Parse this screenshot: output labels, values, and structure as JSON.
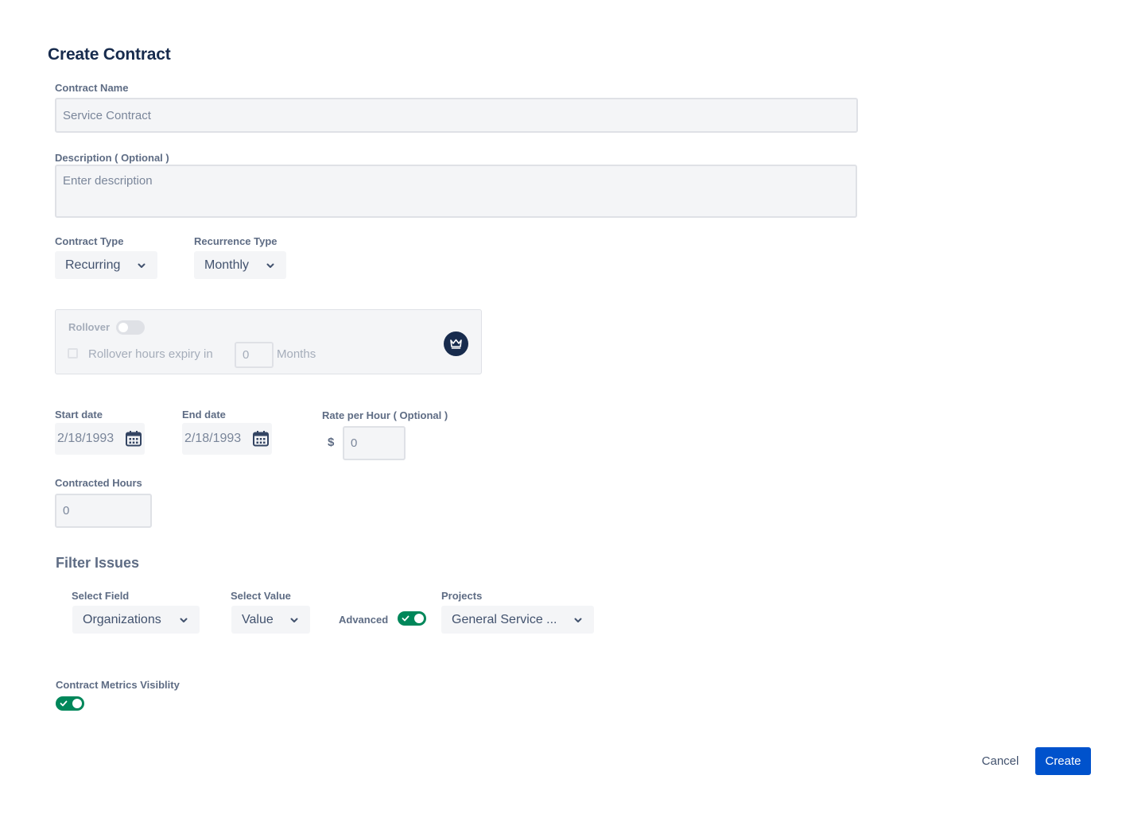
{
  "page": {
    "title": "Create Contract"
  },
  "contract_name": {
    "label": "Contract Name",
    "value": "Service Contract"
  },
  "description": {
    "label": "Description ( Optional )",
    "placeholder": "Enter description"
  },
  "contract_type": {
    "label": "Contract Type",
    "value": "Recurring"
  },
  "recurrence_type": {
    "label": "Recurrence Type",
    "value": "Monthly"
  },
  "rollover": {
    "label": "Rollover",
    "enabled": false,
    "expiry_label": "Rollover hours expiry in",
    "expiry_value": "0",
    "unit": "Months",
    "premium_icon": "crown-icon"
  },
  "start_date": {
    "label": "Start date",
    "value": "2/18/1993"
  },
  "end_date": {
    "label": "End date",
    "value": "2/18/1993"
  },
  "rate": {
    "label": "Rate per Hour ( Optional )",
    "currency": "$",
    "value": "0"
  },
  "contracted_hours": {
    "label": "Contracted Hours",
    "value": "0"
  },
  "filter": {
    "heading": "Filter Issues",
    "select_field": {
      "label": "Select Field",
      "value": "Organizations"
    },
    "select_value": {
      "label": "Select Value",
      "value": "Value"
    },
    "advanced": {
      "label": "Advanced",
      "enabled": true
    },
    "projects": {
      "label": "Projects",
      "value": "General Service ..."
    }
  },
  "metrics": {
    "label": "Contract Metrics Visiblity",
    "enabled": true
  },
  "actions": {
    "cancel": "Cancel",
    "create": "Create"
  },
  "colors": {
    "primary": "#0052cc",
    "toggle_on": "#00875a",
    "heading": "#172b4d",
    "label": "#5e6c84"
  }
}
